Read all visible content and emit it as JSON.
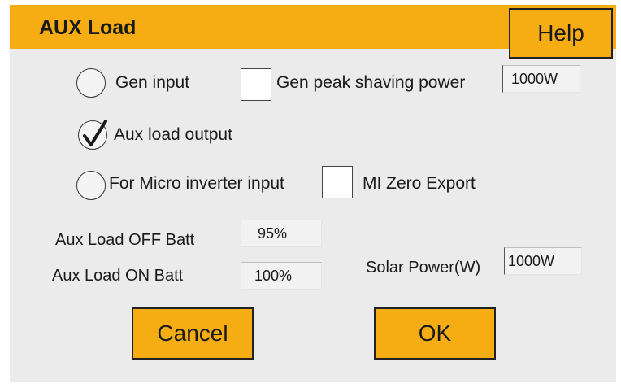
{
  "dialog": {
    "title": "AUX Load",
    "help_label": "Help"
  },
  "options": {
    "gen_input": {
      "label": "Gen input",
      "selected": false
    },
    "aux_load_output": {
      "label": "Aux load output",
      "selected": true
    },
    "micro_inverter_input": {
      "label": "For Micro inverter input",
      "selected": false
    }
  },
  "checkboxes": {
    "gen_peak_shaving": {
      "label": "Gen peak shaving power",
      "checked": false
    },
    "mi_zero_export": {
      "label": "MI Zero Export",
      "checked": false
    }
  },
  "fields": {
    "gen_peak_shaving_power": "1000W",
    "aux_load_off_batt_label": "Aux Load OFF Batt",
    "aux_load_off_batt": "95%",
    "aux_load_on_batt_label": "Aux Load ON Batt",
    "aux_load_on_batt": "100%",
    "solar_power_label": "Solar Power(W)",
    "solar_power": "1000W"
  },
  "buttons": {
    "cancel": "Cancel",
    "ok": "OK"
  },
  "colors": {
    "accent": "#f6ad13",
    "panel": "#ebebeb",
    "text": "#1a1a1a"
  }
}
